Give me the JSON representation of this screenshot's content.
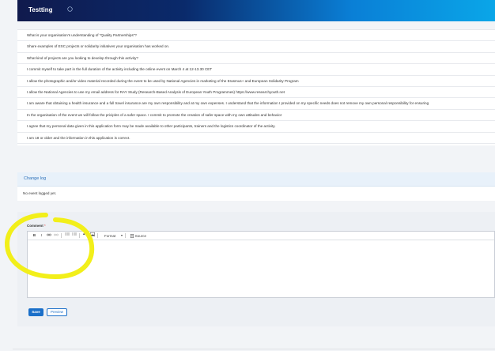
{
  "header": {
    "title": "Testting"
  },
  "questions": [
    "What is your organisation's understanding of \"Quality Partnerships\"?",
    "Share examples of ESC projects or solidarity initiatives your organisation has worked on.",
    "What kind of projects are you looking to develop through this activity?",
    "I commit myself to take part in the full duration of the activity including the online event on March 4 at 12-13.30 CET",
    "I allow the photographic and/or video material recorded during the event to be used by National Agencies in marketing of the Erasmus+ and European Solidarity Program",
    "I allow the National Agencies to use my email address for RAY Study (Research-Based Analysis of European Youth Programmes) https://www.researchyouth.net",
    "I am aware that obtaining a health insurance and a full travel insurance are my own responsibility and at my own expenses. I understand that the information I provided on my specific needs does not remove my own personal responsibility for ensuring",
    "In the organisation of the event we will follow the priciples of a safer space. I commit to promote the creation of safer space with my own attitudes and behavior",
    "I agree that my personal data given in this application form may be made available to other participants, trainers and the logistics coordinator of the activity.",
    "I am 18 or older and the information in this application is correct."
  ],
  "changelog": {
    "title": "Change log",
    "empty_text": "No event logged yet."
  },
  "comment": {
    "label": "Comment",
    "required_marker": "*",
    "toolbar": {
      "bold": "B",
      "italic": "I",
      "format_label": "Format",
      "source_label": "Source"
    }
  },
  "buttons": {
    "save": "Save",
    "preview": "Preview"
  },
  "colors": {
    "accent": "#1a6fc9",
    "highlight": "#f2ef1a"
  }
}
